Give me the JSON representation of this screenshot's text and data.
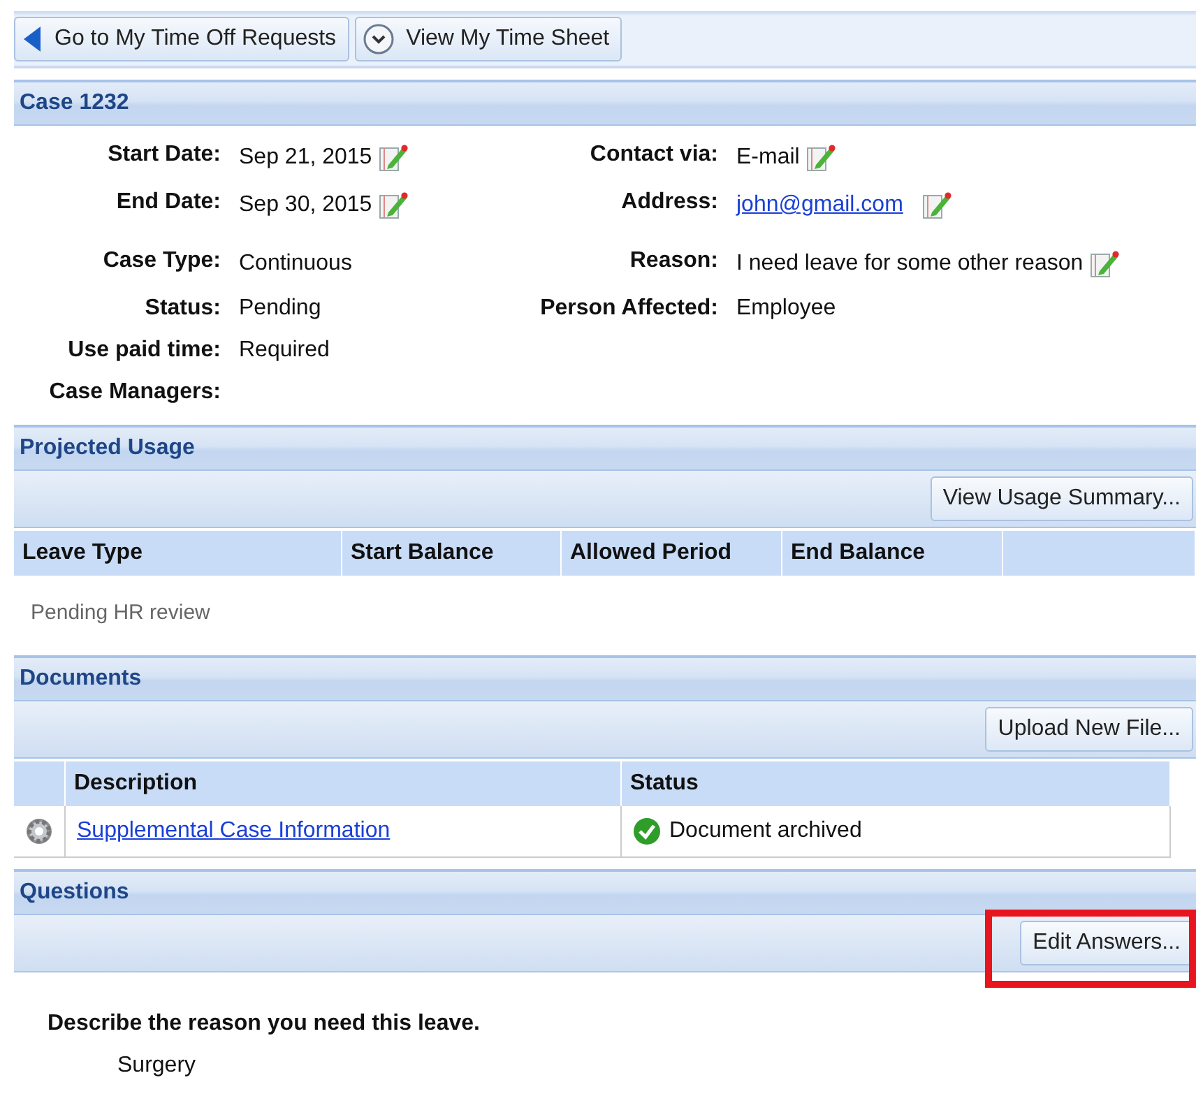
{
  "toolbar": {
    "buttons": [
      {
        "kind": "back",
        "label": "Go to My Time Off Requests"
      },
      {
        "kind": "clock",
        "label": "View My Time Sheet"
      }
    ]
  },
  "case": {
    "title": "Case 1232",
    "rows": [
      {
        "left": {
          "label": "Start Date:",
          "value": "Sep 21, 2015",
          "kind": "text",
          "editable": true
        },
        "right": {
          "label": "Contact via:",
          "value": "E-mail",
          "kind": "text",
          "editable": true
        }
      },
      {
        "left": {
          "label": "End Date:",
          "value": "Sep 30, 2015",
          "kind": "text",
          "editable": true
        },
        "right": {
          "label": "Address:",
          "value": "john@gmail.com",
          "kind": "link",
          "editable": true
        }
      },
      {
        "left": {
          "label": "Case Type:",
          "value": "Continuous",
          "kind": "text",
          "editable": false
        },
        "right": {
          "label": "Reason:",
          "value": "I need leave for some other reason",
          "kind": "text",
          "editable": true
        }
      },
      {
        "left": {
          "label": "Status:",
          "value": "Pending",
          "kind": "text",
          "editable": false
        },
        "right": {
          "label": "Person Affected:",
          "value": "Employee",
          "kind": "text",
          "editable": false
        }
      },
      {
        "left": {
          "label": "Use paid time:",
          "value": "Required",
          "kind": "text",
          "editable": false
        }
      },
      {
        "left": {
          "label": "Case Managers:",
          "editable": false
        }
      }
    ]
  },
  "projected_usage": {
    "title": "Projected Usage",
    "button": {
      "label": "View Usage Summary...",
      "highlighted": false
    },
    "columns": [
      "Leave Type",
      "Start Balance",
      "Allowed Period",
      "End Balance"
    ],
    "empty_text": "Pending HR review"
  },
  "documents": {
    "title": "Documents",
    "button": {
      "label": "Upload New File...",
      "highlighted": false
    },
    "columns": [
      "Description",
      "Status"
    ],
    "rows": [
      {
        "description": "Supplemental Case Information",
        "status": "Document archived"
      }
    ]
  },
  "questions": {
    "title": "Questions",
    "button": {
      "label": "Edit Answers...",
      "highlighted": true
    },
    "items": [
      {
        "question": "Describe the reason you need this leave.",
        "answer": "Surgery"
      }
    ]
  }
}
